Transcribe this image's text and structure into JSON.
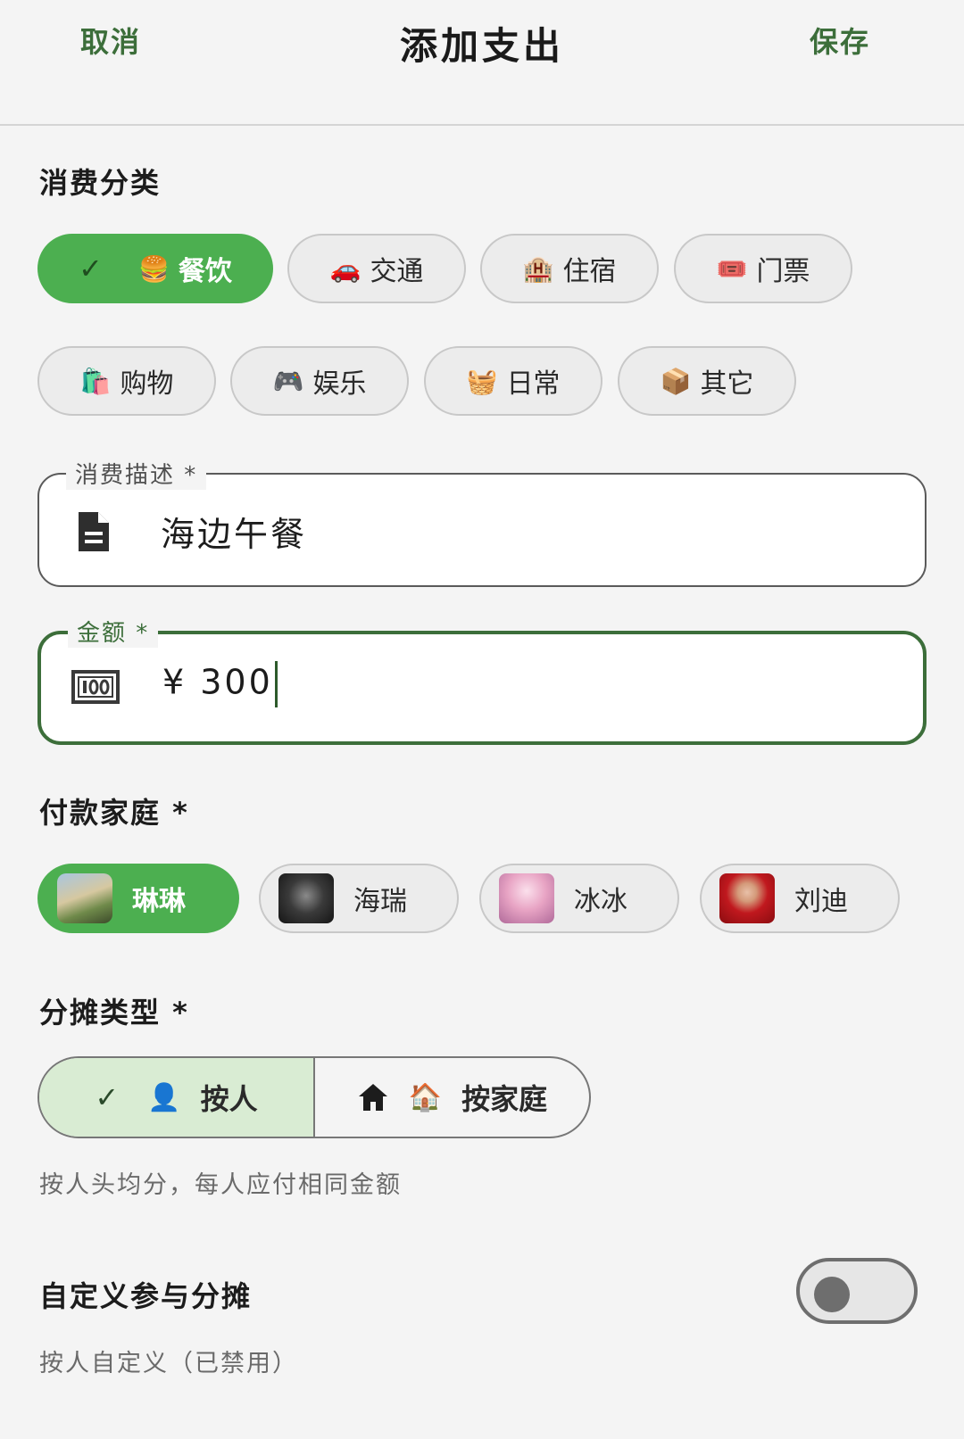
{
  "header": {
    "cancel_label": "取消",
    "title": "添加支出",
    "save_label": "保存"
  },
  "category": {
    "label": "消费分类",
    "selected": "餐饮",
    "items": [
      {
        "emoji": "🍔",
        "label": "餐饮",
        "selected": true
      },
      {
        "emoji": "🚗",
        "label": "交通",
        "selected": false
      },
      {
        "emoji": "🏨",
        "label": "住宿",
        "selected": false
      },
      {
        "emoji": "🎟️",
        "label": "门票",
        "selected": false
      },
      {
        "emoji": "🛍️",
        "label": "购物",
        "selected": false
      },
      {
        "emoji": "🎮",
        "label": "娱乐",
        "selected": false
      },
      {
        "emoji": "🧺",
        "label": "日常",
        "selected": false
      },
      {
        "emoji": "📦",
        "label": "其它",
        "selected": false
      }
    ],
    "check_icon": "✓"
  },
  "description": {
    "label": "消费描述 *",
    "value": "海边午餐",
    "icon": "document-icon"
  },
  "amount": {
    "label": "金额 *",
    "value": "¥ 300",
    "icon": "banknote-icon"
  },
  "payer": {
    "label": "付款家庭 *",
    "selected": "琳琳",
    "items": [
      {
        "label": "琳琳",
        "selected": true
      },
      {
        "label": "海瑞",
        "selected": false
      },
      {
        "label": "冰冰",
        "selected": false
      },
      {
        "label": "刘迪",
        "selected": false
      }
    ]
  },
  "split_type": {
    "label": "分摊类型 *",
    "options": [
      {
        "emoji": "👤",
        "label": "按人",
        "selected": true
      },
      {
        "emoji": "🏠",
        "label": "按家庭",
        "selected": false
      }
    ],
    "hint": "按人头均分，每人应付相同金额"
  },
  "custom_split": {
    "label": "自定义参与分摊",
    "enabled": false,
    "hint": "按人自定义（已禁用）"
  },
  "colors": {
    "accent": "#4caf50",
    "header_text": "#3c6e3a",
    "segment_selected": "#d9ecd3"
  }
}
